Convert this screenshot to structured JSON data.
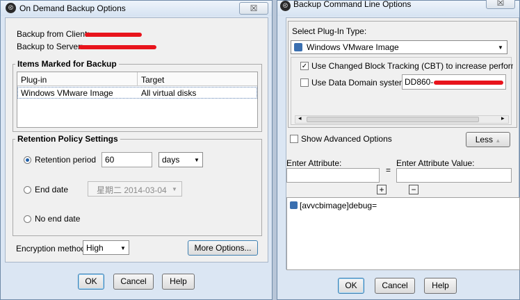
{
  "left": {
    "title": "On Demand Backup Options",
    "close": "☒",
    "backup_from_label": "Backup from Client:",
    "backup_to_label": "Backup to Server:",
    "items_group": "Items Marked for Backup",
    "col_plugin": "Plug-in",
    "col_target": "Target",
    "row_plugin": "Windows VMware Image",
    "row_target": "All virtual disks",
    "retention_group": "Retention Policy Settings",
    "retention_period_label": "Retention period",
    "retention_value": "60",
    "retention_unit": "days",
    "end_date_label": "End date",
    "end_date_value": "星期二 2014-03-04",
    "no_end_label": "No end date",
    "encryption_label": "Encryption method",
    "encryption_value": "High",
    "more_options": "More Options...",
    "ok": "OK",
    "cancel": "Cancel",
    "help": "Help"
  },
  "right": {
    "title": "Backup Command Line Options",
    "close": "☒",
    "select_plugin_label": "Select Plug-In Type:",
    "plugin_value": "Windows VMware Image",
    "cbt_label": "Use Changed Block Tracking (CBT) to increase performar",
    "dd_label": "Use Data Domain system",
    "dd_value": "DD860-",
    "show_adv": "Show Advanced Options",
    "less": "Less",
    "enter_attr": "Enter Attribute:",
    "equals": "=",
    "enter_val": "Enter Attribute Value:",
    "plus": "+",
    "minus": "−",
    "list_item": "[avvcbimage]debug=",
    "ok": "OK",
    "cancel": "Cancel",
    "help": "Help"
  }
}
